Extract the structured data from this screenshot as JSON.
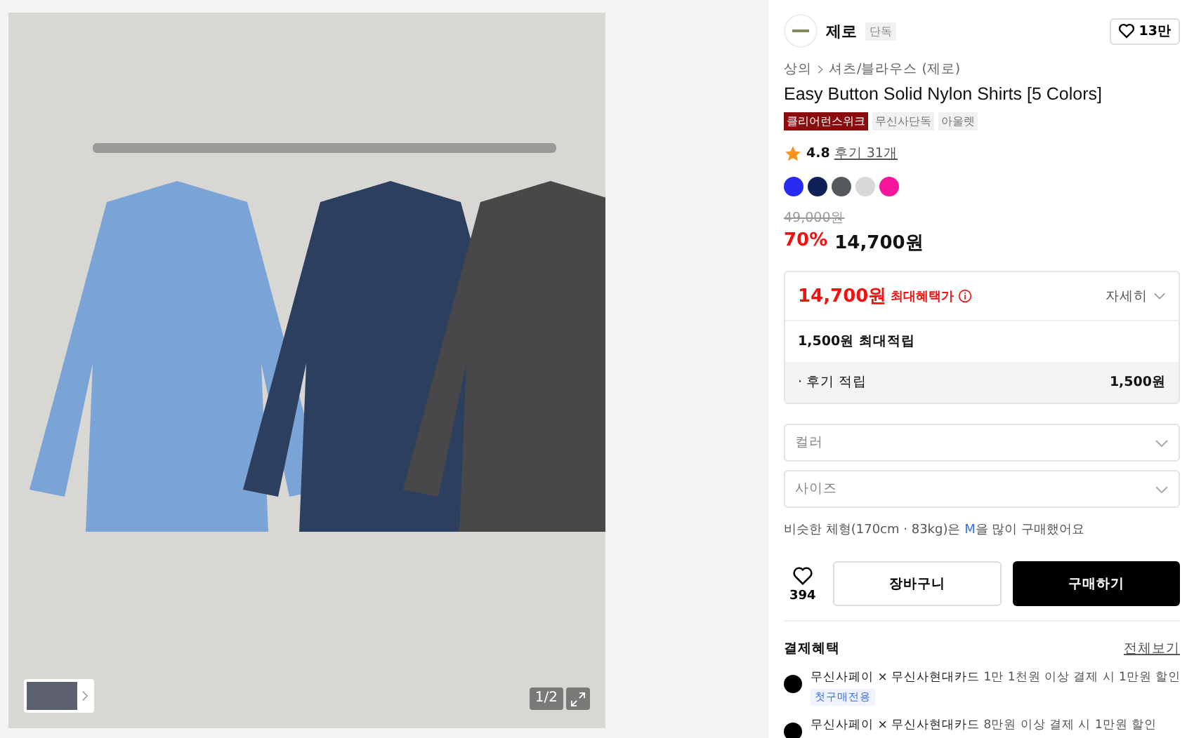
{
  "gallery": {
    "counter": "1/2"
  },
  "brand": {
    "name": "제로",
    "badge": "단독",
    "likes": "13만"
  },
  "breadcrumb": [
    "상의",
    "셔츠/블라우스 (제로)"
  ],
  "title": "Easy Button Solid Nylon Shirts [5 Colors]",
  "tags": [
    {
      "label": "클리어런스위크",
      "kind": "event"
    },
    {
      "label": "무신사단독",
      "kind": "plain"
    },
    {
      "label": "아울렛",
      "kind": "plain"
    }
  ],
  "rating": {
    "score": "4.8",
    "reviews": "후기 31개"
  },
  "colors": [
    {
      "color": "#2a2af5"
    },
    {
      "color": "#0f2257"
    },
    {
      "color": "#55585c"
    },
    {
      "color": "#d8d8d8"
    },
    {
      "color": "#f5169b"
    }
  ],
  "price": {
    "original": "49,000원",
    "discount": "70%",
    "current": "14,700원"
  },
  "benefit": {
    "price": "14,700원",
    "label": "최대혜택가",
    "detail": "자세히",
    "points": "1,500원 최대적립",
    "rows": [
      {
        "label": "· 후기 적립",
        "value": "1,500원"
      }
    ]
  },
  "options": [
    {
      "placeholder": "컬러"
    },
    {
      "placeholder": "사이즈"
    }
  ],
  "size_hint": {
    "before": "비슷한 체형(170cm · 83kg)은 ",
    "size": "M",
    "after": "을 많이 구매했어요"
  },
  "actions": {
    "wishes": "394",
    "cart": "장바구니",
    "buy": "구매하기"
  },
  "payment": {
    "title": "결제혜택",
    "more": "전체보기",
    "items": [
      {
        "main": "무신사페이 × 무신사현대카드",
        "detail": "1만 1천원 이상 결제 시 1만원 할인",
        "tag": "첫구매전용"
      },
      {
        "main": "무신사페이 × 무신사현대카드",
        "detail": "8만원 이상 결제 시 1만원 할인"
      }
    ]
  }
}
